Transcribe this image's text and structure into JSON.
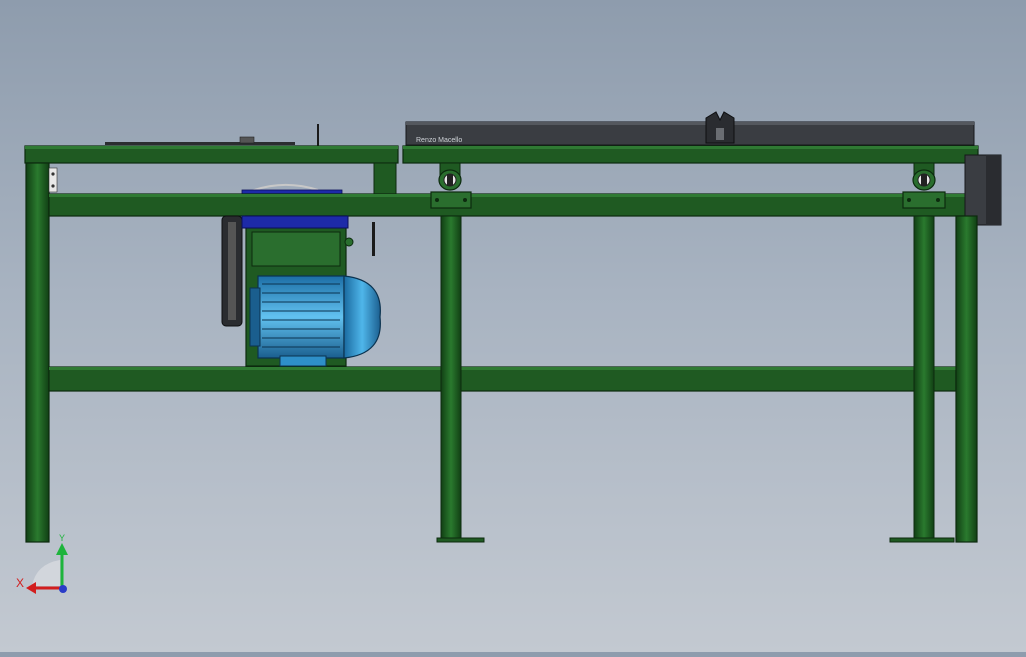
{
  "viewport": {
    "background_top": "#8e9cad",
    "background_bottom": "#c3c9d1"
  },
  "model": {
    "rail_label": "Renzo Macello",
    "frame_color": "#1f5a22",
    "frame_edge": "#0c2a0e",
    "motor_color": "#2e8fc8",
    "rail_color": "#3a3d42"
  },
  "triad": {
    "x_label": "X",
    "y_label": "Y",
    "x_color": "#d21e1e",
    "y_color": "#1eb43c",
    "z_color": "#2a3cc8"
  }
}
